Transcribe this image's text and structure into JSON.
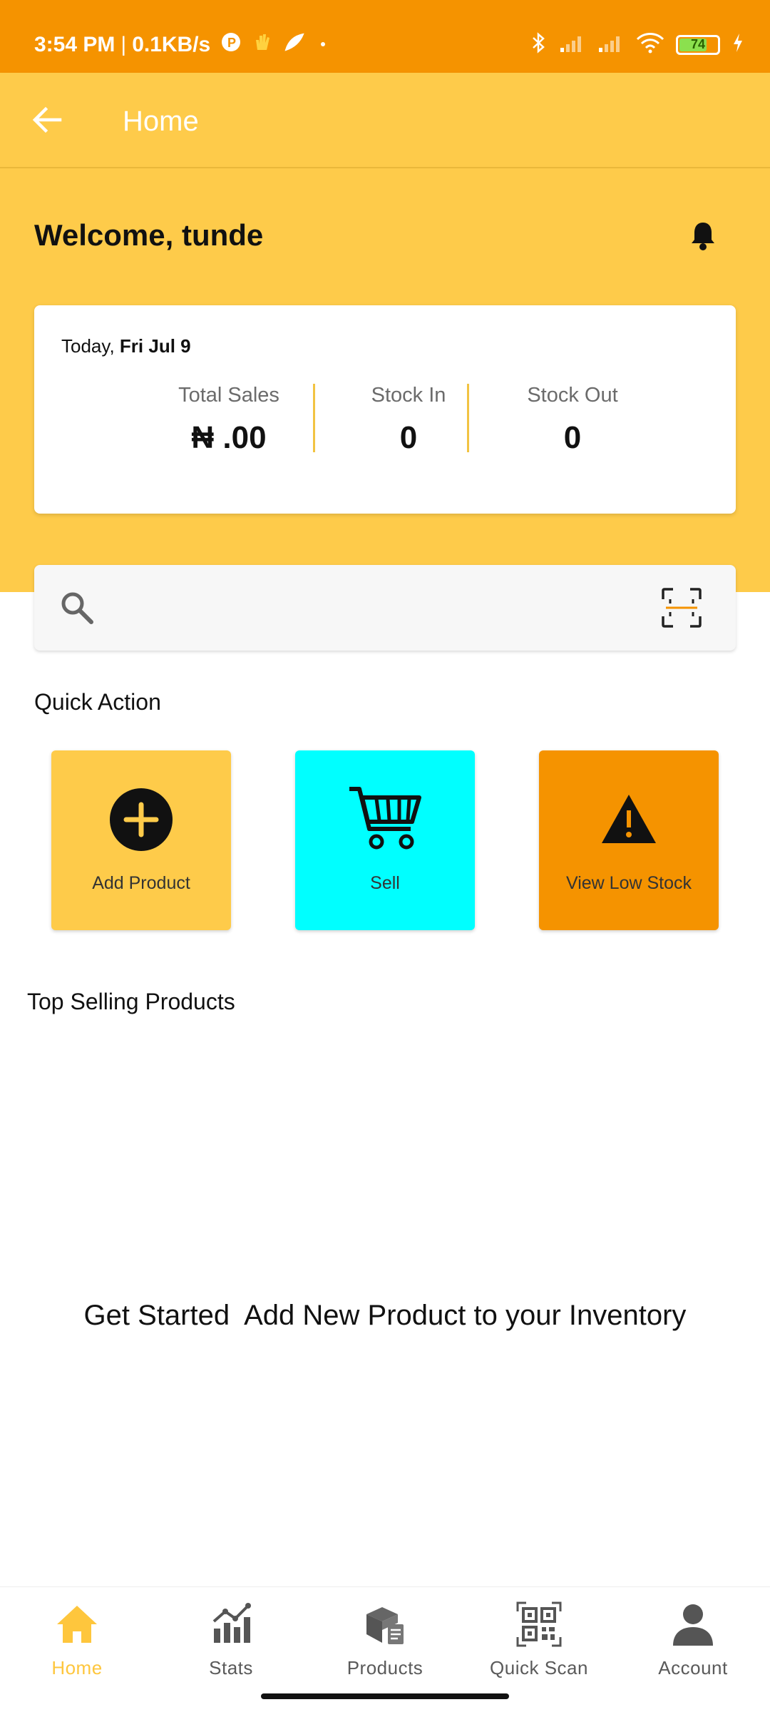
{
  "status_bar": {
    "time": "3:54 PM",
    "separator": "|",
    "speed": "0.1KB/s",
    "battery": "74",
    "battery_level": 0.74
  },
  "app_bar": {
    "title": "Home"
  },
  "welcome": "Welcome, tunde",
  "summary": {
    "date_prefix": "Today,",
    "date": "Fri Jul 9",
    "stats": [
      {
        "label": "Total Sales",
        "value": "₦ .00"
      },
      {
        "label": "Stock In",
        "value": "0"
      },
      {
        "label": "Stock Out",
        "value": "0"
      }
    ]
  },
  "search": {
    "placeholder": ""
  },
  "quick_action": {
    "title": "Quick Action",
    "items": [
      {
        "label": "Add Product",
        "color": "#FECB4A",
        "icon": "plus-circle-icon"
      },
      {
        "label": "Sell",
        "color": "#00FFFF",
        "icon": "cart-icon"
      },
      {
        "label": "View Low Stock",
        "color": "#F59300",
        "icon": "warning-icon"
      }
    ]
  },
  "top_selling": {
    "title": "Top Selling Products",
    "empty_message": "Get Started  Add New Product to your Inventory"
  },
  "bottom_nav": {
    "items": [
      {
        "label": "Home",
        "icon": "home-icon",
        "active": true
      },
      {
        "label": "Stats",
        "icon": "stats-icon",
        "active": false
      },
      {
        "label": "Products",
        "icon": "products-icon",
        "active": false
      },
      {
        "label": "Quick Scan",
        "icon": "qr-icon",
        "active": false
      },
      {
        "label": "Account",
        "icon": "account-icon",
        "active": false
      }
    ]
  },
  "colors": {
    "status_bar": "#F59300",
    "primary": "#FECB4A",
    "active_nav": "#FEC63D"
  }
}
